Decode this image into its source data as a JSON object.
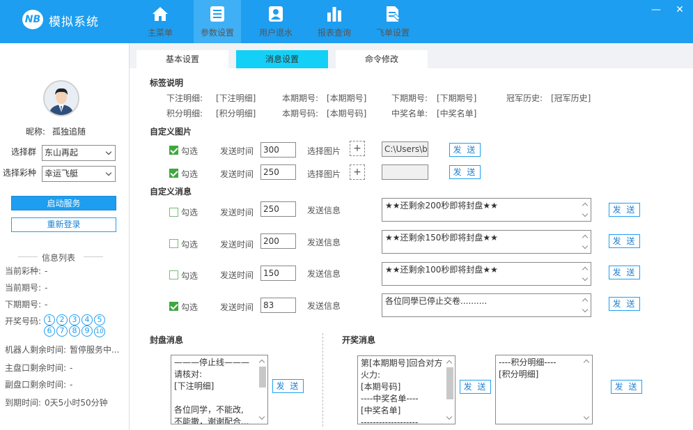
{
  "app": {
    "logo_text": "NB",
    "title": "模拟系统"
  },
  "nav": [
    {
      "label": "主菜单",
      "icon": "home-icon"
    },
    {
      "label": "参数设置",
      "icon": "settings-list-icon"
    },
    {
      "label": "用户退水",
      "icon": "user-badge-icon"
    },
    {
      "label": "报表查询",
      "icon": "bar-chart-icon"
    },
    {
      "label": "飞单设置",
      "icon": "document-edit-icon"
    }
  ],
  "window": {
    "minimize": "—",
    "close": "✕"
  },
  "sidebar": {
    "nickname_label": "昵称:",
    "nickname": "孤独追随",
    "group_label": "选择群",
    "group_value": "东山再起",
    "lottery_label": "选择彩种",
    "lottery_value": "幸运飞艇",
    "start_button": "启动服务",
    "relogin_button": "重新登录",
    "info_title": "信息列表",
    "info": [
      {
        "label": "当前彩种:",
        "value": "-"
      },
      {
        "label": "当前期号:",
        "value": "-"
      },
      {
        "label": "下期期号:",
        "value": "-"
      },
      {
        "label": "开奖号码:",
        "value": ""
      },
      {
        "label": "机器人剩余时间:",
        "value": "暂停服务中..."
      },
      {
        "label": "主盘口剩余时间:",
        "value": "-"
      },
      {
        "label": "副盘口剩余时间:",
        "value": "-"
      },
      {
        "label": "到期时间:",
        "value": "0天5小时50分钟"
      }
    ],
    "balls": [
      "1",
      "2",
      "3",
      "4",
      "5",
      "6",
      "7",
      "8",
      "9",
      "10"
    ]
  },
  "tabs": [
    {
      "label": "基本设置",
      "active": false
    },
    {
      "label": "消息设置",
      "active": true
    },
    {
      "label": "命令修改",
      "active": false
    }
  ],
  "labels_section": {
    "title": "标签说明",
    "rows": [
      [
        {
          "name": "下注明细:",
          "tag": "[下注明细]"
        },
        {
          "name": "本期期号:",
          "tag": "[本期期号]"
        },
        {
          "name": "下期期号:",
          "tag": "[下期期号]"
        },
        {
          "name": "冠军历史:",
          "tag": "[冠军历史]"
        }
      ],
      [
        {
          "name": "积分明细:",
          "tag": "[积分明细]"
        },
        {
          "name": "本期号码:",
          "tag": "[本期号码]"
        },
        {
          "name": "中奖名单:",
          "tag": "[中奖名单]"
        }
      ]
    ]
  },
  "custom_image": {
    "title": "自定义图片",
    "check_label": "勾选",
    "time_label": "发送时间",
    "pick_label": "选择图片",
    "send": "发 送",
    "rows": [
      {
        "checked": true,
        "time": "300",
        "path": "C:\\Users\\b"
      },
      {
        "checked": true,
        "time": "250",
        "path": ""
      }
    ]
  },
  "custom_message": {
    "title": "自定义消息",
    "check_label": "勾选",
    "time_label": "发送时间",
    "msg_label": "发送信息",
    "send": "发 送",
    "rows": [
      {
        "checked": false,
        "time": "250",
        "text": "★★还剩余200秒即将封盘★★"
      },
      {
        "checked": false,
        "time": "200",
        "text": "★★还剩余150秒即将封盘★★"
      },
      {
        "checked": false,
        "time": "150",
        "text": "★★还剩余100秒即将封盘★★"
      },
      {
        "checked": true,
        "time": "83",
        "text": "各位同學已停止交卷.........."
      }
    ]
  },
  "seal": {
    "title": "封盘消息",
    "text": "———停止线———\n请核对:\n[下注明细]\n\n各位同学，不能改,\n不能撤，谢谢配合...",
    "send": "发 送"
  },
  "draw": {
    "title": "开奖消息",
    "text": "第[本期期号]回合对方火力:\n[本期号码]\n----中奖名单----\n[中奖名单]\n-------------------",
    "text2": "----积分明细----\n[积分明细]",
    "send": "发 送",
    "send2": "发 送"
  },
  "colors": {
    "primary": "#1e9ef0",
    "tab_active": "#14d0f6",
    "check": "#3da83d"
  }
}
